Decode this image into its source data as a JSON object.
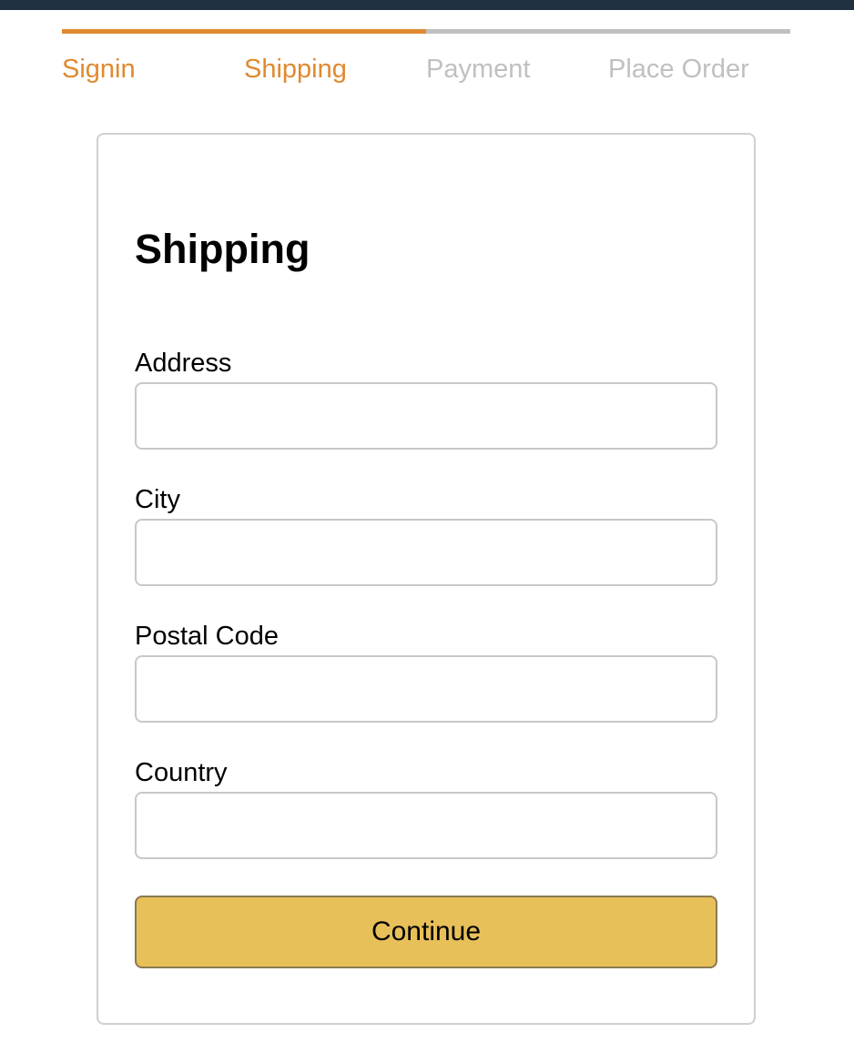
{
  "steps": [
    {
      "label": "Signin",
      "active": true
    },
    {
      "label": "Shipping",
      "active": true
    },
    {
      "label": "Payment",
      "active": false
    },
    {
      "label": "Place Order",
      "active": false
    }
  ],
  "form": {
    "title": "Shipping",
    "fields": {
      "address": {
        "label": "Address",
        "value": ""
      },
      "city": {
        "label": "City",
        "value": ""
      },
      "postal_code": {
        "label": "Postal Code",
        "value": ""
      },
      "country": {
        "label": "Country",
        "value": ""
      }
    },
    "continue_label": "Continue"
  },
  "colors": {
    "top_bar": "#203040",
    "step_active": "#e08a30",
    "step_inactive": "#c0c0c0",
    "button": "#e8c05a"
  }
}
